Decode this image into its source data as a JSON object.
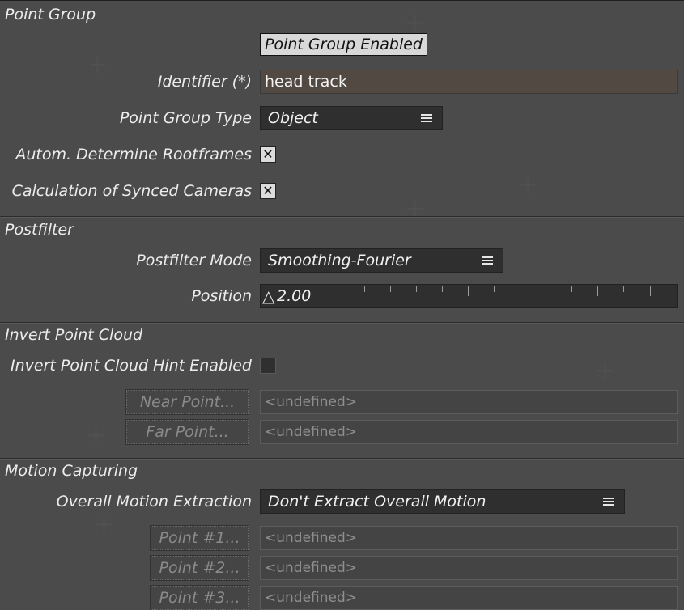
{
  "point_group": {
    "header": "Point Group",
    "enabled_label": "Point Group Enabled",
    "identifier_label": "Identifier (*)",
    "identifier_value": "head track",
    "type_label": "Point Group Type",
    "type_value": "Object",
    "rootframes_label": "Autom. Determine Rootframes",
    "rootframes_checked": "✕",
    "synced_label": "Calculation of Synced Cameras",
    "synced_checked": "✕"
  },
  "postfilter": {
    "header": "Postfilter",
    "mode_label": "Postfilter Mode",
    "mode_value": "Smoothing-Fourier",
    "position_label": "Position",
    "position_delta": "△",
    "position_value": "2.00"
  },
  "invert_point_cloud": {
    "header": "Invert Point Cloud",
    "hint_label": "Invert Point Cloud Hint Enabled",
    "near_button": "Near Point...",
    "near_value": "<undefined>",
    "far_button": "Far Point...",
    "far_value": "<undefined>"
  },
  "motion_capturing": {
    "header": "Motion Capturing",
    "extraction_label": "Overall Motion Extraction",
    "extraction_value": "Don't Extract Overall Motion",
    "points": [
      {
        "button": "Point #1...",
        "value": "<undefined>"
      },
      {
        "button": "Point #2...",
        "value": "<undefined>"
      },
      {
        "button": "Point #3...",
        "value": "<undefined>"
      }
    ]
  },
  "colors": {
    "panel_bg": "#4b4b4b",
    "dropdown_bg": "#2f2f2f",
    "input_bg": "#524a42",
    "toggle_bg": "#d8d8d8"
  },
  "icons": {
    "dropdown": "menu-lines-icon",
    "checkbox": "x-mark-icon",
    "slider": "delta-icon"
  }
}
